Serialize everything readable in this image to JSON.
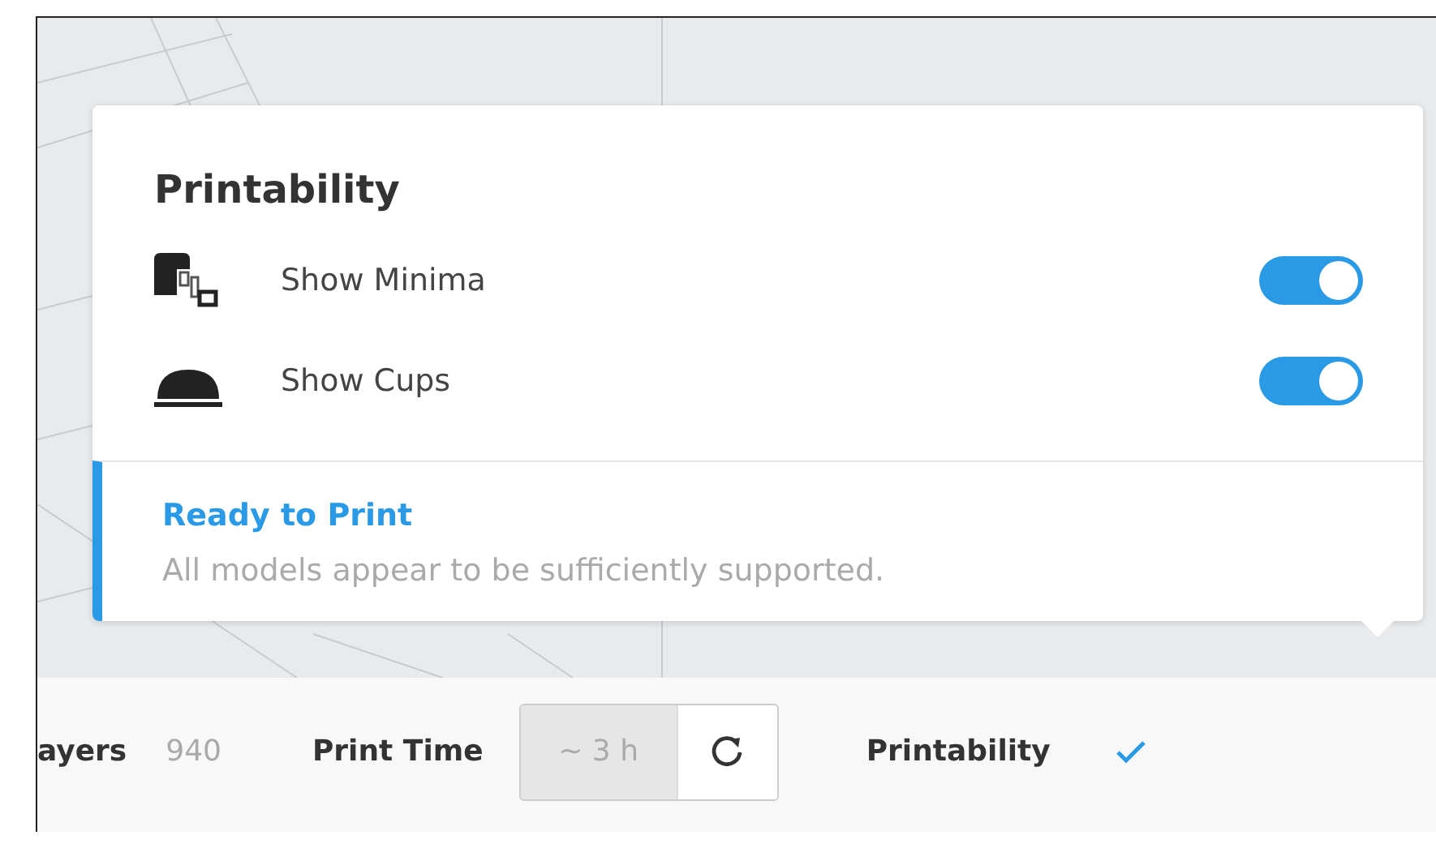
{
  "popover": {
    "title": "Printability",
    "options": [
      {
        "label": "Show Minima",
        "kind": "minima",
        "on": true
      },
      {
        "label": "Show Cups",
        "kind": "cups",
        "on": true
      }
    ],
    "status": {
      "title": "Ready to Print",
      "message": "All models appear to be sufficiently supported."
    }
  },
  "status_bar": {
    "layers_label": "ayers",
    "layers_value": "940",
    "time_label": "Print Time",
    "time_value": "~ 3 h",
    "time_disabled": true,
    "printability_label": "Printability",
    "printable": true
  }
}
